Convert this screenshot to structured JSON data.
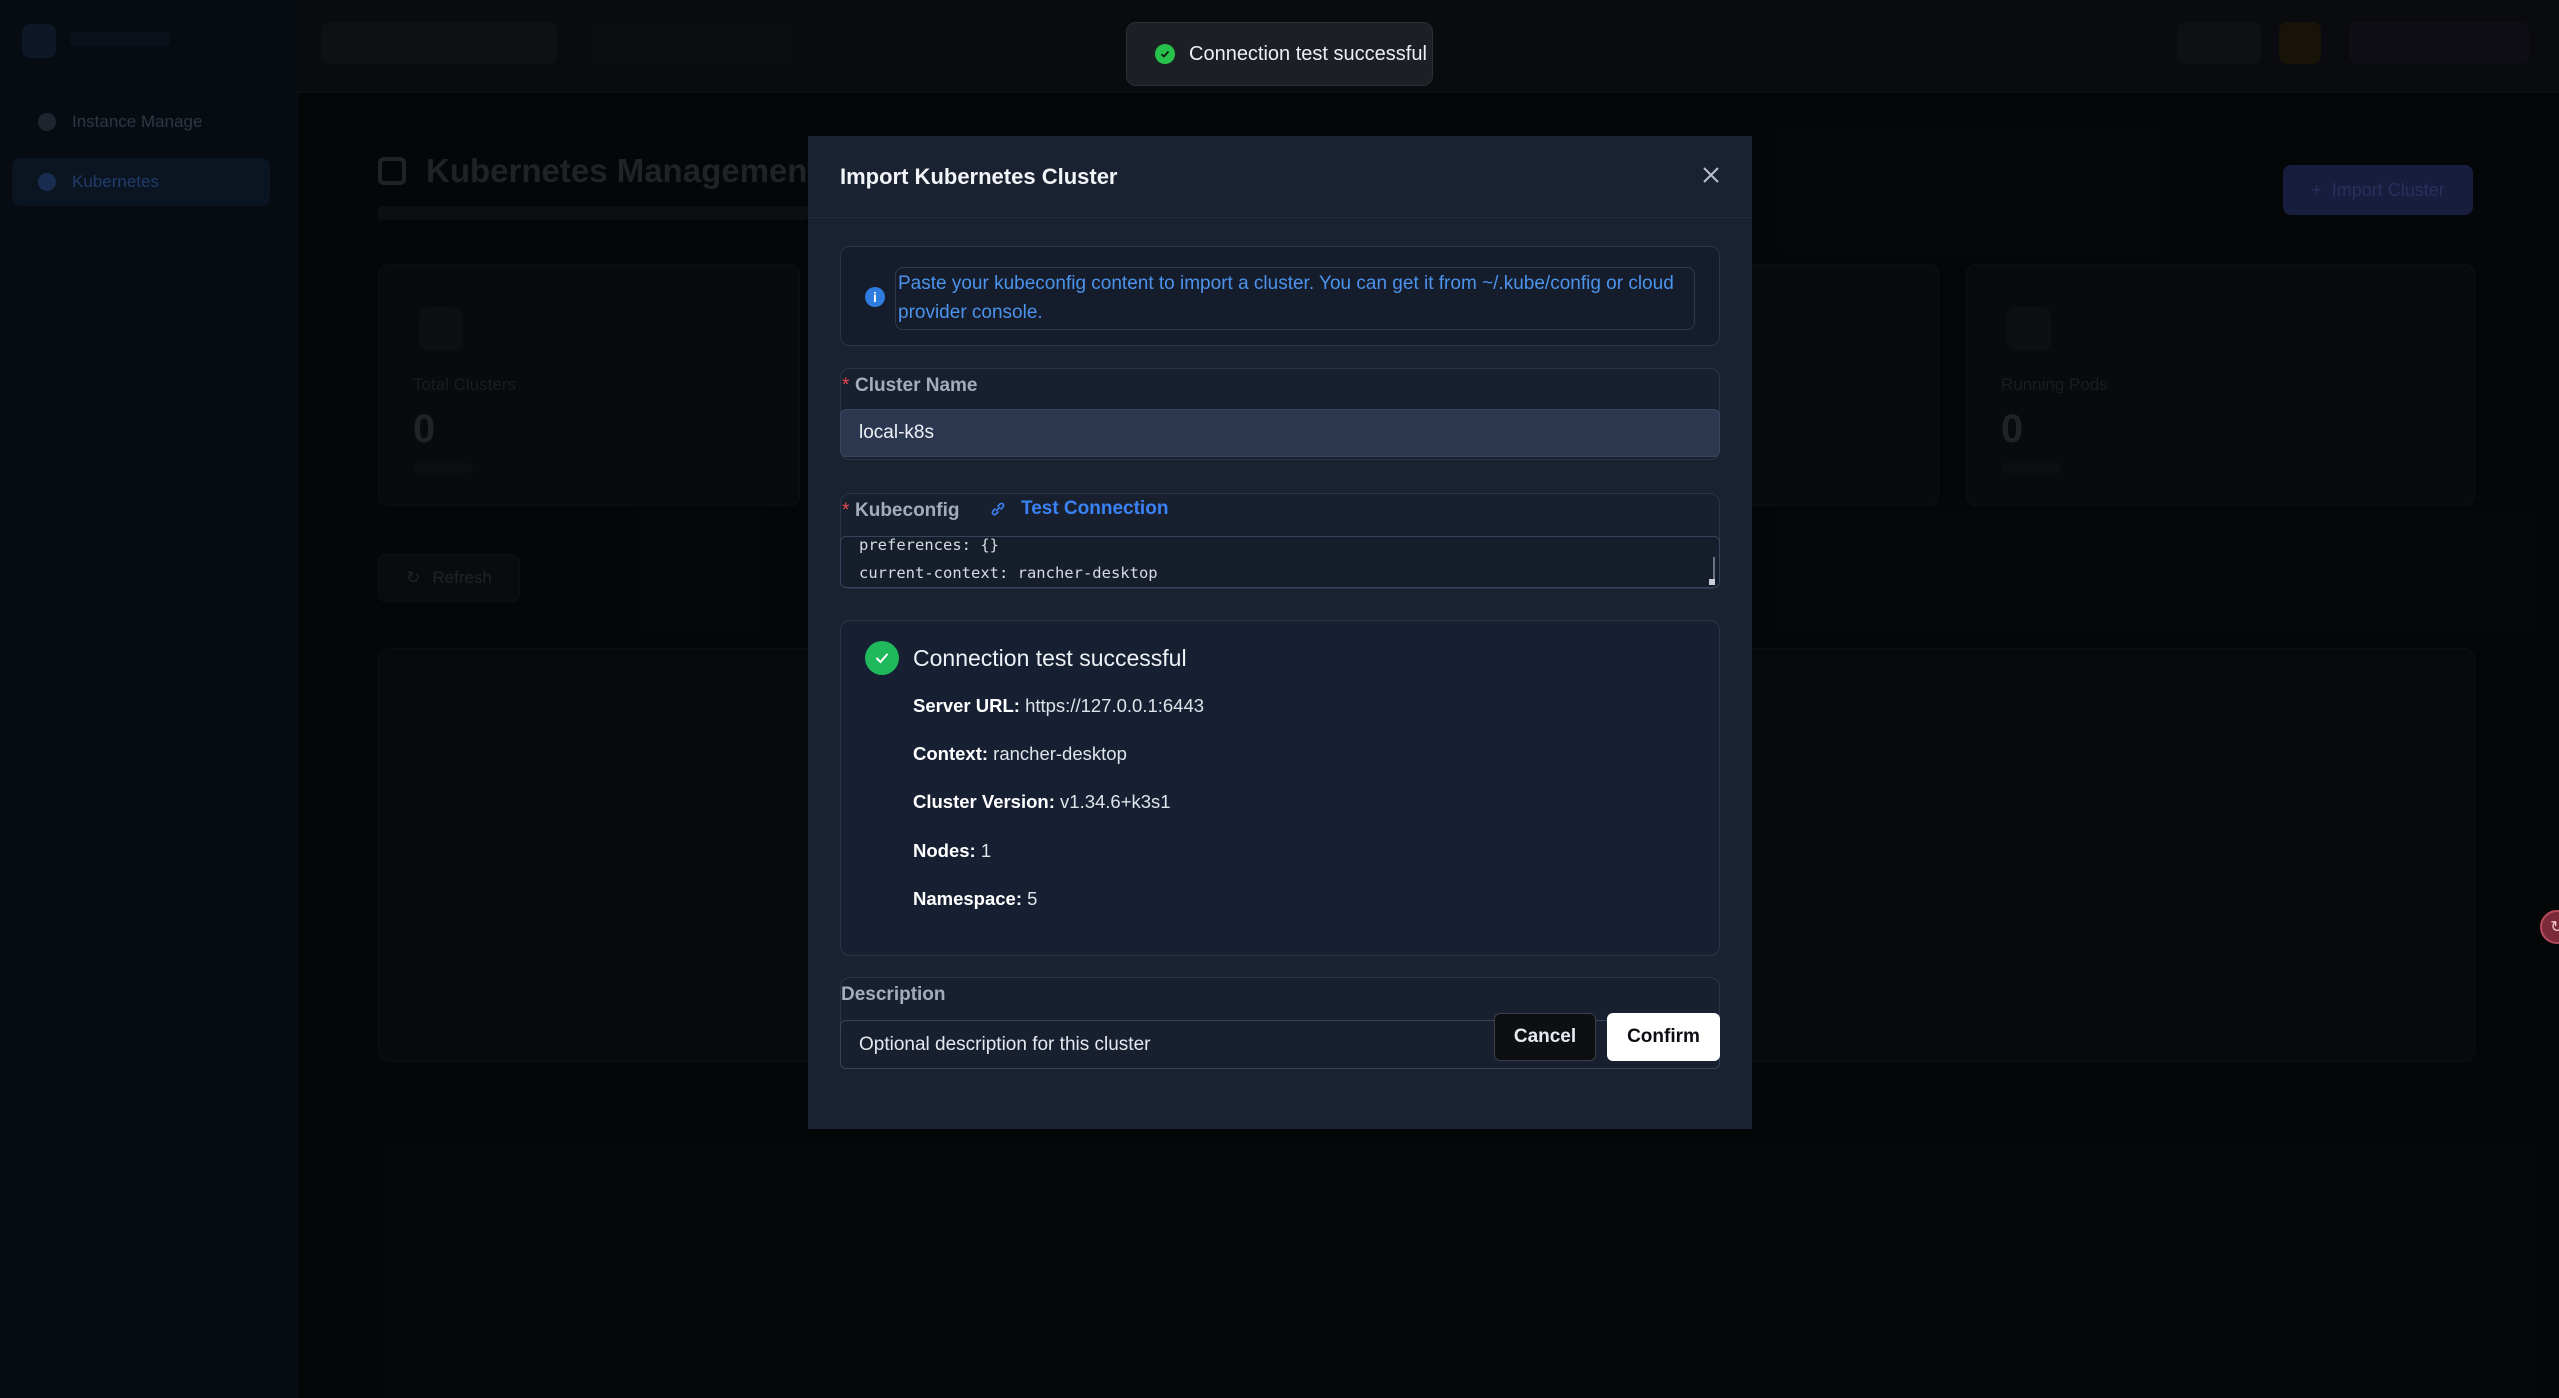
{
  "background": {
    "page_title": "Kubernetes Management",
    "sidebar_items": [
      "Instance Manage",
      "Kubernetes"
    ],
    "import_button_label": "Import Cluster",
    "stat_cards": [
      {
        "label": "Total Clusters",
        "value": "0"
      },
      {
        "label": "Running Pods",
        "value": "0"
      }
    ],
    "refresh_label": "Refresh"
  },
  "toast": {
    "message": "Connection test successful",
    "icon": "check-circle-icon"
  },
  "modal": {
    "title": "Import Kubernetes Cluster",
    "info_text": "Paste your kubeconfig content to import a cluster. You can get it from ~/.kube/config or cloud provider console.",
    "cluster_name": {
      "label": "Cluster Name",
      "value": "local-k8s"
    },
    "kubeconfig": {
      "label": "Kubeconfig",
      "test_connection_label": "Test Connection",
      "lines": [
        "preferences: {}",
        "current-context: rancher-desktop"
      ]
    },
    "result": {
      "title": "Connection test successful",
      "rows": [
        {
          "key": "Server URL:",
          "value": "https://127.0.0.1:6443"
        },
        {
          "key": "Context:",
          "value": "rancher-desktop"
        },
        {
          "key": "Cluster Version:",
          "value": "v1.34.6+k3s1"
        },
        {
          "key": "Nodes:",
          "value": "1"
        },
        {
          "key": "Namespace:",
          "value": "5"
        }
      ]
    },
    "description": {
      "label": "Description",
      "placeholder": "Optional description for this cluster"
    },
    "cancel_label": "Cancel",
    "confirm_label": "Confirm"
  },
  "colors": {
    "success": "#27c24c",
    "link": "#3b82f6",
    "required": "#e5484d",
    "modal_bg": "#1a2131"
  }
}
